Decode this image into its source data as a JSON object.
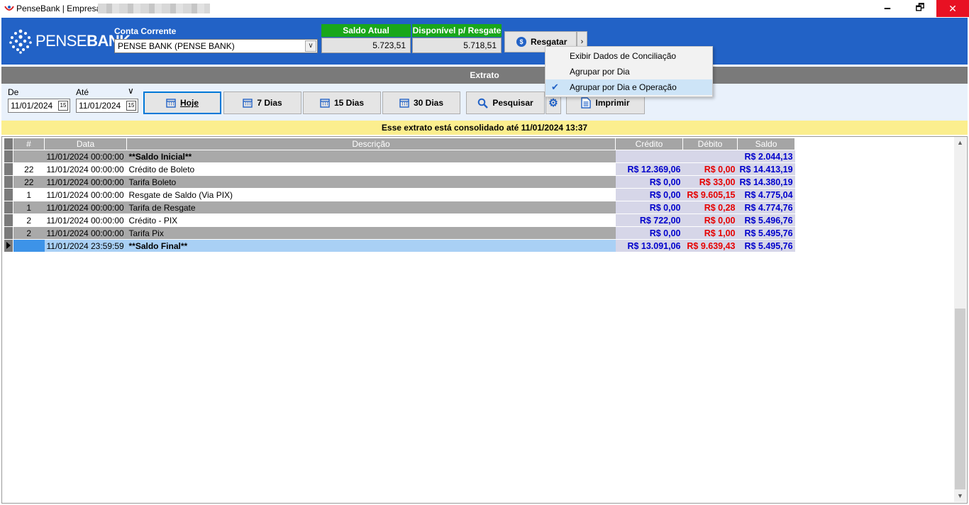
{
  "window": {
    "title": "PenseBank | Empresa:",
    "min": "🗕",
    "restore": "🗗",
    "close": "✕"
  },
  "header": {
    "logo_text_a": "PENSE",
    "logo_text_b": "BANK",
    "conta_label": "Conta Corrente",
    "conta_value": "PENSE BANK (PENSE BANK)",
    "saldo_atual_label": "Saldo Atual",
    "saldo_atual_value": "5.723,51",
    "disponivel_label": "Disponível p/ Resgate",
    "disponivel_value": "5.718,51",
    "resgatar_label": "Resgatar"
  },
  "extrato_title": "Extrato",
  "filter": {
    "de_label": "De",
    "ate_label": "Até",
    "de_value": "11/01/2024",
    "ate_value": "11/01/2024",
    "hoje": "Hoje",
    "d7": "7 Dias",
    "d15": "15 Dias",
    "d30": "30 Dias",
    "pesquisar": "Pesquisar",
    "imprimir": "Imprimir"
  },
  "consolidation": "Esse extrato está consolidado até 11/01/2024 13:37",
  "menu": {
    "items": [
      {
        "label": "Exibir Dados de Conciliação",
        "checked": false
      },
      {
        "label": "Agrupar por Dia",
        "checked": false
      },
      {
        "label": "Agrupar por Dia e Operação",
        "checked": true
      }
    ]
  },
  "grid": {
    "columns": [
      "#",
      "Data",
      "Descrição",
      "Crédito",
      "Débito",
      "Saldo"
    ],
    "rows": [
      {
        "num": "",
        "data": "11/01/2024 00:00:00",
        "desc": "**Saldo Inicial**",
        "credito": "",
        "debito": "",
        "saldo": "R$ 2.044,13",
        "style": "g",
        "bold": true
      },
      {
        "num": "22",
        "data": "11/01/2024 00:00:00",
        "desc": "Crédito de Boleto",
        "credito": "R$ 12.369,06",
        "debito": "R$ 0,00",
        "saldo": "R$ 14.413,19",
        "style": "w",
        "bold": false
      },
      {
        "num": "22",
        "data": "11/01/2024 00:00:00",
        "desc": "Tarifa Boleto",
        "credito": "R$ 0,00",
        "debito": "R$ 33,00",
        "saldo": "R$ 14.380,19",
        "style": "g",
        "bold": false
      },
      {
        "num": "1",
        "data": "11/01/2024 00:00:00",
        "desc": "Resgate de Saldo (Via PIX)",
        "credito": "R$ 0,00",
        "debito": "R$ 9.605,15",
        "saldo": "R$ 4.775,04",
        "style": "w",
        "bold": false
      },
      {
        "num": "1",
        "data": "11/01/2024 00:00:00",
        "desc": "Tarifa de Resgate",
        "credito": "R$ 0,00",
        "debito": "R$ 0,28",
        "saldo": "R$ 4.774,76",
        "style": "g",
        "bold": false
      },
      {
        "num": "2",
        "data": "11/01/2024 00:00:00",
        "desc": "Crédito - PIX",
        "credito": "R$ 722,00",
        "debito": "R$ 0,00",
        "saldo": "R$ 5.496,76",
        "style": "w",
        "bold": false
      },
      {
        "num": "2",
        "data": "11/01/2024 00:00:00",
        "desc": "Tarifa Pix",
        "credito": "R$ 0,00",
        "debito": "R$ 1,00",
        "saldo": "R$ 5.495,76",
        "style": "g",
        "bold": false
      },
      {
        "num": "",
        "data": "11/01/2024 23:59:59",
        "desc": "**Saldo Final**",
        "credito": "R$ 13.091,06",
        "debito": "R$ 9.639,43",
        "saldo": "R$ 5.495,76",
        "style": "f",
        "bold": true
      }
    ]
  },
  "colors": {
    "header_blue": "#2262c6",
    "green_label": "#19a71a",
    "credit_blue": "#0000cc",
    "debit_red": "#e60000",
    "consolidation_yellow": "#fbee8e"
  }
}
